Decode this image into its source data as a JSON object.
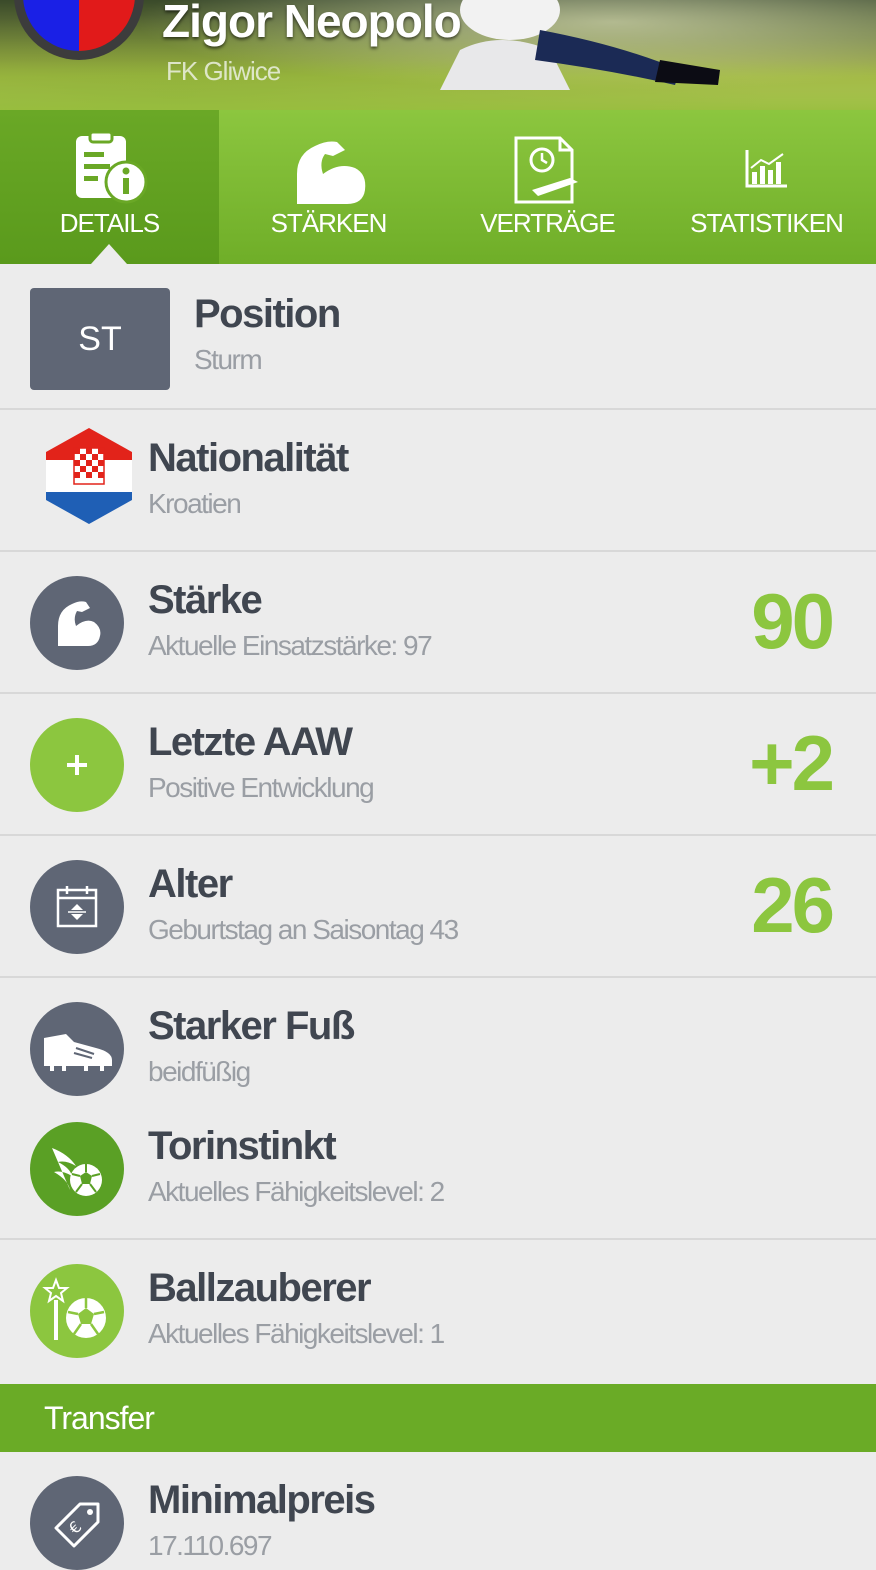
{
  "header": {
    "player_name": "Zigor Neopolo",
    "club_name": "FK Gliwice"
  },
  "tabs": [
    {
      "label": "DETAILS",
      "icon": "details-doc-info-icon",
      "active": true
    },
    {
      "label": "STÄRKEN",
      "icon": "flexed-arm-icon",
      "active": false
    },
    {
      "label": "VERTRÄGE",
      "icon": "contract-clock-icon",
      "active": false
    },
    {
      "label": "STATISTIKEN",
      "icon": "bar-chart-icon",
      "active": false
    }
  ],
  "details": {
    "position": {
      "badge": "ST",
      "title": "Position",
      "sub": "Sturm"
    },
    "nationality": {
      "title": "Nationalität",
      "sub": "Kroatien",
      "icon": "croatia-flag-icon"
    },
    "strength": {
      "title": "Stärke",
      "sub": "Aktuelle Einsatzstärke: 97",
      "value": "90",
      "icon": "flexed-arm-icon"
    },
    "last_aaw": {
      "title": "Letzte AAW",
      "sub": "Positive Entwicklung",
      "value": "+2",
      "icon": "plus-icon"
    },
    "age": {
      "title": "Alter",
      "sub": "Geburtstag an Saisontag 43",
      "value": "26",
      "icon": "calendar-icon"
    },
    "strong_foot": {
      "title": "Starker Fuß",
      "sub": "beidfüßig",
      "icon": "football-boot-icon"
    },
    "goal_instinct": {
      "title": "Torinstinkt",
      "sub": "Aktuelles Fähigkeitslevel: 2",
      "icon": "flaming-ball-icon"
    },
    "ball_wizard": {
      "title": "Ballzauberer",
      "sub": "Aktuelles Fähigkeitslevel: 1",
      "icon": "magic-wand-ball-icon"
    }
  },
  "transfer": {
    "section_label": "Transfer",
    "min_price": {
      "title": "Minimalpreis",
      "sub": "17.110.697",
      "icon": "euro-price-tag-icon"
    }
  },
  "colors": {
    "accent_green": "#8cc63f",
    "dark_green": "#6aab26",
    "slate": "#5f6675",
    "background": "#ececec"
  }
}
